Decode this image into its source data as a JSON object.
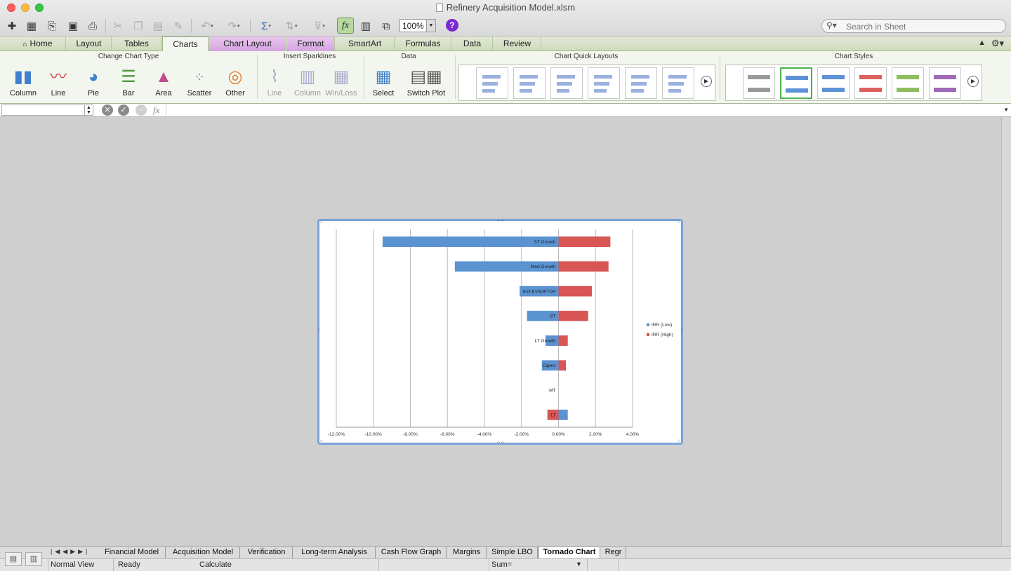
{
  "window": {
    "title": "Refinery Acquisition Model.xlsm"
  },
  "toolbar": {
    "zoom": "100%",
    "search_placeholder": "Search in Sheet",
    "icons": [
      "new-icon",
      "templates-icon",
      "open-icon",
      "save-icon",
      "print-icon",
      "cut-icon",
      "copy-icon",
      "paste-icon",
      "format-painter-icon",
      "undo-icon",
      "redo-icon",
      "autosum-icon",
      "sort-icon",
      "filter-icon",
      "fx-icon",
      "formula-builder-icon",
      "media-icon",
      "help-icon"
    ]
  },
  "tabs": [
    {
      "label": "Home"
    },
    {
      "label": "Layout"
    },
    {
      "label": "Tables"
    },
    {
      "label": "Charts"
    },
    {
      "label": "Chart Layout"
    },
    {
      "label": "Format"
    },
    {
      "label": "SmartArt"
    },
    {
      "label": "Formulas"
    },
    {
      "label": "Data"
    },
    {
      "label": "Review"
    }
  ],
  "ribbon": {
    "groups": {
      "change_chart_type": "Change Chart Type",
      "insert_sparklines": "Insert Sparklines",
      "data": "Data",
      "chart_quick_layouts": "Chart Quick Layouts",
      "chart_styles": "Chart Styles"
    },
    "chart_types": [
      {
        "label": "Column"
      },
      {
        "label": "Line"
      },
      {
        "label": "Pie"
      },
      {
        "label": "Bar"
      },
      {
        "label": "Area"
      },
      {
        "label": "Scatter"
      },
      {
        "label": "Other"
      }
    ],
    "sparklines": [
      {
        "label": "Line"
      },
      {
        "label": "Column"
      },
      {
        "label": "Win/Loss"
      }
    ],
    "data_buttons": [
      {
        "label": "Select"
      },
      {
        "label": "Switch Plot"
      }
    ],
    "style_colors": [
      "#888888",
      "#3f7fd0",
      "#3f7fd0",
      "#d64545",
      "#7bb342",
      "#8e4fa8"
    ],
    "selected_style_index": 1
  },
  "chart_data": {
    "type": "bar",
    "orientation": "horizontal",
    "categories": [
      "ST Growth",
      "Med Growth",
      "Exit EV/EBITDA",
      "ST",
      "LT Growth",
      "Capex",
      "MT",
      "LT"
    ],
    "series": [
      {
        "name": "IRR (Low)",
        "color": "#5b93d1",
        "values": [
          -0.095,
          -0.056,
          -0.021,
          -0.017,
          -0.007,
          -0.009,
          0,
          0.005
        ]
      },
      {
        "name": "IRR (High)",
        "color": "#d85656",
        "values": [
          0.028,
          0.027,
          0.018,
          0.016,
          0.005,
          0.004,
          0,
          -0.006
        ]
      }
    ],
    "xlim": [
      -0.12,
      0.04
    ],
    "xticks": [
      "-12.00%",
      "-10.00%",
      "-8.00%",
      "-6.00%",
      "-4.00%",
      "-2.00%",
      "0.00%",
      "2.00%",
      "4.00%"
    ],
    "grid": true,
    "legend": "right"
  },
  "sheet_tabs": [
    {
      "label": "Financial Model"
    },
    {
      "label": "Acquisition Model"
    },
    {
      "label": "Verification"
    },
    {
      "label": "Long-term Analysis"
    },
    {
      "label": "Cash Flow Graph"
    },
    {
      "label": "Margins"
    },
    {
      "label": "Simple LBO"
    },
    {
      "label": "Tornado Chart"
    },
    {
      "label": "Regr"
    }
  ],
  "active_sheet_index": 7,
  "status": {
    "view": "Normal View",
    "state": "Ready",
    "calc": "Calculate",
    "sum": "Sum="
  }
}
